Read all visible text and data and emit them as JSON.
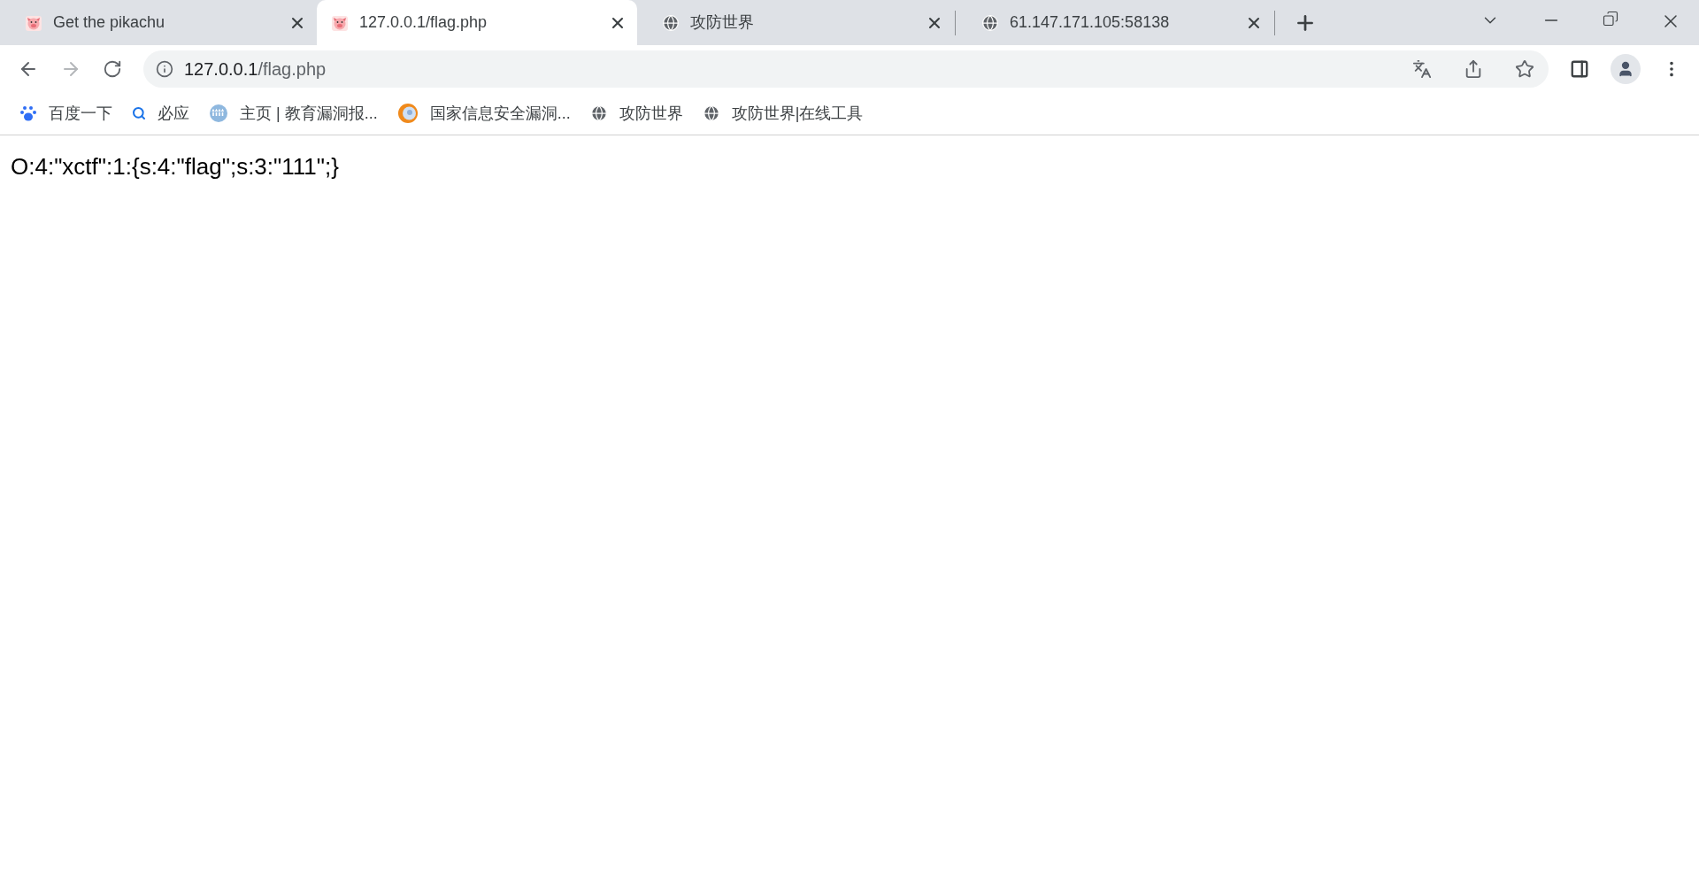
{
  "tabs": [
    {
      "title": "Get the pikachu",
      "kind": "pig",
      "selected": false
    },
    {
      "title": "127.0.0.1/flag.php",
      "kind": "pig",
      "selected": true
    },
    {
      "title": "攻防世界",
      "kind": "globe",
      "selected": false
    },
    {
      "title": "61.147.171.105:58138",
      "kind": "globe",
      "selected": false
    }
  ],
  "address_bar": {
    "host": "127.0.0.1",
    "path": "/flag.php"
  },
  "bookmarks": [
    {
      "label": "百度一下",
      "kind": "paw"
    },
    {
      "label": "必应",
      "kind": "search"
    },
    {
      "label": "主页 | 教育漏洞报...",
      "kind": "people"
    },
    {
      "label": "国家信息安全漏洞...",
      "kind": "orb"
    },
    {
      "label": "攻防世界",
      "kind": "globe"
    },
    {
      "label": "攻防世界|在线工具",
      "kind": "globe"
    }
  ],
  "page": {
    "text": "O:4:\"xctf\":1:{s:4:\"flag\";s:3:\"111\";}"
  }
}
